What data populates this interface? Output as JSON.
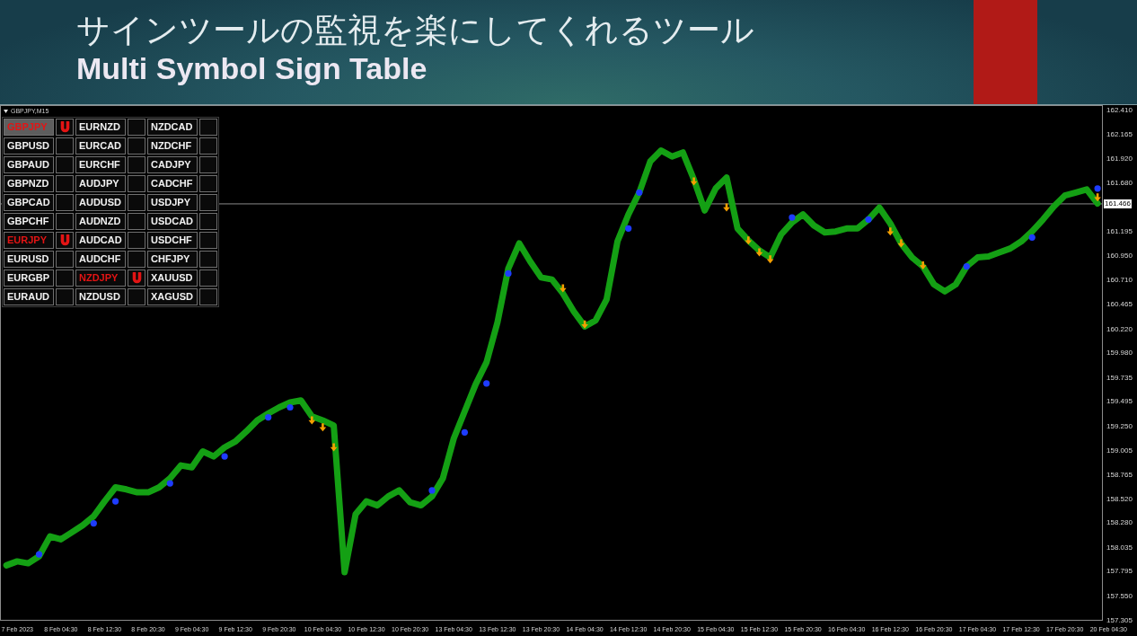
{
  "header": {
    "title": "サインツールの監視を楽にしてくれるツール",
    "subtitle": "Multi Symbol Sign Table"
  },
  "chart": {
    "chart_data": {
      "type": "line",
      "title": "GBPJPY,M15",
      "categories": [
        null,
        "7 Feb 2023",
        null,
        null,
        null,
        "8 Feb 04:30",
        null,
        null,
        null,
        "8 Feb 12:30",
        null,
        null,
        null,
        "8 Feb 20:30",
        null,
        null,
        null,
        "9 Feb 04:30",
        null,
        null,
        null,
        "9 Feb 12:30",
        null,
        null,
        null,
        "9 Feb 20:30",
        null,
        null,
        null,
        "10 Feb 04:30",
        null,
        null,
        null,
        "10 Feb 12:30",
        null,
        null,
        null,
        "10 Feb 20:30",
        null,
        null,
        null,
        "13 Feb 04:30",
        null,
        null,
        null,
        "13 Feb 12:30",
        null,
        null,
        null,
        "13 Feb 20:30",
        null,
        null,
        null,
        "14 Feb 04:30",
        null,
        null,
        null,
        "14 Feb 12:30",
        null,
        null,
        null,
        "14 Feb 20:30",
        null,
        null,
        null,
        "15 Feb 04:30",
        null,
        null,
        null,
        "15 Feb 12:30",
        null,
        null,
        null,
        "15 Feb 20:30",
        null,
        null,
        null,
        "16 Feb 04:30",
        null,
        null,
        null,
        "16 Feb 12:30",
        null,
        null,
        null,
        "16 Feb 20:30",
        null,
        null,
        null,
        "17 Feb 04:30",
        null,
        null,
        null,
        "17 Feb 12:30",
        null,
        null,
        null,
        "17 Feb 20:30",
        null,
        null,
        null,
        "20 Feb 04:30"
      ],
      "series": [
        {
          "color": "#14a014",
          "values": [
            157.85,
            157.89,
            157.87,
            157.94,
            158.14,
            158.11,
            158.18,
            158.25,
            158.34,
            158.49,
            158.63,
            158.61,
            158.58,
            158.58,
            158.63,
            158.72,
            158.85,
            158.83,
            158.99,
            158.94,
            159.03,
            159.09,
            159.19,
            159.3,
            159.37,
            159.43,
            159.48,
            159.5,
            159.34,
            159.3,
            159.25,
            157.78,
            158.36,
            158.49,
            158.45,
            158.54,
            158.6,
            158.48,
            158.45,
            158.54,
            158.72,
            159.12,
            159.39,
            159.66,
            159.88,
            160.28,
            160.82,
            161.07,
            160.89,
            160.73,
            160.71,
            160.57,
            160.39,
            160.24,
            160.3,
            160.51,
            161.09,
            161.36,
            161.58,
            161.89,
            162.0,
            161.94,
            161.98,
            161.71,
            161.4,
            161.62,
            161.73,
            161.22,
            161.1,
            161.0,
            160.93,
            161.16,
            161.28,
            161.36,
            161.25,
            161.18,
            161.19,
            161.22,
            161.22,
            161.31,
            161.43,
            161.27,
            161.07,
            160.93,
            160.84,
            160.66,
            160.59,
            160.66,
            160.84,
            160.93,
            160.94,
            160.98,
            161.02,
            161.09,
            161.19,
            161.31,
            161.44,
            161.55,
            161.58,
            161.61,
            161.47,
            null
          ]
        },
        {
          "type": "scatter",
          "marker": "triangle",
          "color": "#f5a000",
          "values": [
            null,
            null,
            null,
            null,
            null,
            null,
            null,
            null,
            null,
            null,
            null,
            null,
            null,
            null,
            null,
            null,
            null,
            null,
            null,
            null,
            null,
            null,
            null,
            null,
            null,
            null,
            null,
            null,
            159.3,
            159.23,
            159.03,
            null,
            null,
            null,
            null,
            null,
            null,
            null,
            null,
            null,
            null,
            null,
            null,
            null,
            null,
            null,
            null,
            null,
            null,
            null,
            null,
            160.62,
            null,
            160.26,
            null,
            null,
            null,
            null,
            null,
            null,
            null,
            null,
            null,
            161.69,
            null,
            null,
            161.43,
            null,
            161.1,
            160.98,
            160.91,
            null,
            null,
            null,
            null,
            null,
            null,
            null,
            null,
            null,
            null,
            161.19,
            161.07,
            null,
            160.85,
            null,
            null,
            null,
            null,
            null,
            null,
            null,
            null,
            null,
            null,
            null,
            null,
            null,
            null,
            null,
            161.53,
            null
          ]
        },
        {
          "type": "scatter",
          "marker": "circle",
          "color": "#1e3cff",
          "values": [
            null,
            null,
            null,
            157.96,
            null,
            null,
            null,
            null,
            158.27,
            null,
            158.49,
            null,
            null,
            null,
            null,
            158.67,
            null,
            null,
            null,
            null,
            158.94,
            null,
            null,
            null,
            159.33,
            null,
            159.43,
            null,
            null,
            null,
            null,
            null,
            null,
            null,
            null,
            null,
            null,
            null,
            null,
            158.6,
            null,
            null,
            159.18,
            null,
            159.67,
            null,
            160.77,
            null,
            null,
            null,
            null,
            null,
            null,
            null,
            null,
            null,
            null,
            161.22,
            161.58,
            null,
            null,
            null,
            null,
            null,
            null,
            null,
            null,
            null,
            null,
            null,
            null,
            null,
            161.33,
            null,
            null,
            null,
            null,
            null,
            null,
            161.31,
            null,
            null,
            null,
            null,
            null,
            null,
            null,
            null,
            160.84,
            null,
            null,
            null,
            null,
            null,
            161.13,
            null,
            null,
            null,
            null,
            null,
            161.62,
            null
          ]
        }
      ],
      "ylim": [
        157.305,
        162.445
      ],
      "yticks": [
        {
          "value": 162.41,
          "label": "162.410"
        },
        {
          "value": 162.165,
          "label": "162.165"
        },
        {
          "value": 161.92,
          "label": "161.920"
        },
        {
          "value": 161.68,
          "label": "161.680"
        },
        {
          "value": 161.195,
          "label": "161.195"
        },
        {
          "value": 160.95,
          "label": "160.950"
        },
        {
          "value": 160.71,
          "label": "160.710"
        },
        {
          "value": 160.465,
          "label": "160.465"
        },
        {
          "value": 160.22,
          "label": "160.220"
        },
        {
          "value": 159.98,
          "label": "159.980"
        },
        {
          "value": 159.735,
          "label": "159.735"
        },
        {
          "value": 159.495,
          "label": "159.495"
        },
        {
          "value": 159.25,
          "label": "159.250"
        },
        {
          "value": 159.005,
          "label": "159.005"
        },
        {
          "value": 158.765,
          "label": "158.765"
        },
        {
          "value": 158.52,
          "label": "158.520"
        },
        {
          "value": 158.28,
          "label": "158.280"
        },
        {
          "value": 158.035,
          "label": "158.035"
        },
        {
          "value": 157.795,
          "label": "157.795"
        },
        {
          "value": 157.55,
          "label": "157.550"
        },
        {
          "value": 157.305,
          "label": "157.305"
        }
      ],
      "ref_lines": [
        {
          "axis": "y",
          "value": 161.466,
          "label": "161.466"
        }
      ]
    }
  },
  "symbol_table": {
    "rows": [
      [
        {
          "symbol": "GBPJPY",
          "signal": true,
          "selected": true
        },
        {
          "symbol": "EURNZD",
          "signal": false,
          "selected": false
        },
        {
          "symbol": "NZDCAD",
          "signal": false,
          "selected": false
        }
      ],
      [
        {
          "symbol": "GBPUSD",
          "signal": false,
          "selected": false
        },
        {
          "symbol": "EURCAD",
          "signal": false,
          "selected": false
        },
        {
          "symbol": "NZDCHF",
          "signal": false,
          "selected": false
        }
      ],
      [
        {
          "symbol": "GBPAUD",
          "signal": false,
          "selected": false
        },
        {
          "symbol": "EURCHF",
          "signal": false,
          "selected": false
        },
        {
          "symbol": "CADJPY",
          "signal": false,
          "selected": false
        }
      ],
      [
        {
          "symbol": "GBPNZD",
          "signal": false,
          "selected": false
        },
        {
          "symbol": "AUDJPY",
          "signal": false,
          "selected": false
        },
        {
          "symbol": "CADCHF",
          "signal": false,
          "selected": false
        }
      ],
      [
        {
          "symbol": "GBPCAD",
          "signal": false,
          "selected": false
        },
        {
          "symbol": "AUDUSD",
          "signal": false,
          "selected": false
        },
        {
          "symbol": "USDJPY",
          "signal": false,
          "selected": false
        }
      ],
      [
        {
          "symbol": "GBPCHF",
          "signal": false,
          "selected": false
        },
        {
          "symbol": "AUDNZD",
          "signal": false,
          "selected": false
        },
        {
          "symbol": "USDCAD",
          "signal": false,
          "selected": false
        }
      ],
      [
        {
          "symbol": "EURJPY",
          "signal": true,
          "selected": false
        },
        {
          "symbol": "AUDCAD",
          "signal": false,
          "selected": false
        },
        {
          "symbol": "USDCHF",
          "signal": false,
          "selected": false
        }
      ],
      [
        {
          "symbol": "EURUSD",
          "signal": false,
          "selected": false
        },
        {
          "symbol": "AUDCHF",
          "signal": false,
          "selected": false
        },
        {
          "symbol": "CHFJPY",
          "signal": false,
          "selected": false
        }
      ],
      [
        {
          "symbol": "EURGBP",
          "signal": false,
          "selected": false
        },
        {
          "symbol": "NZDJPY",
          "signal": true,
          "selected": false
        },
        {
          "symbol": "XAUUSD",
          "signal": false,
          "selected": false
        }
      ],
      [
        {
          "symbol": "EURAUD",
          "signal": false,
          "selected": false
        },
        {
          "symbol": "NZDUSD",
          "signal": false,
          "selected": false
        },
        {
          "symbol": "XAGUSD",
          "signal": false,
          "selected": false
        }
      ]
    ]
  }
}
